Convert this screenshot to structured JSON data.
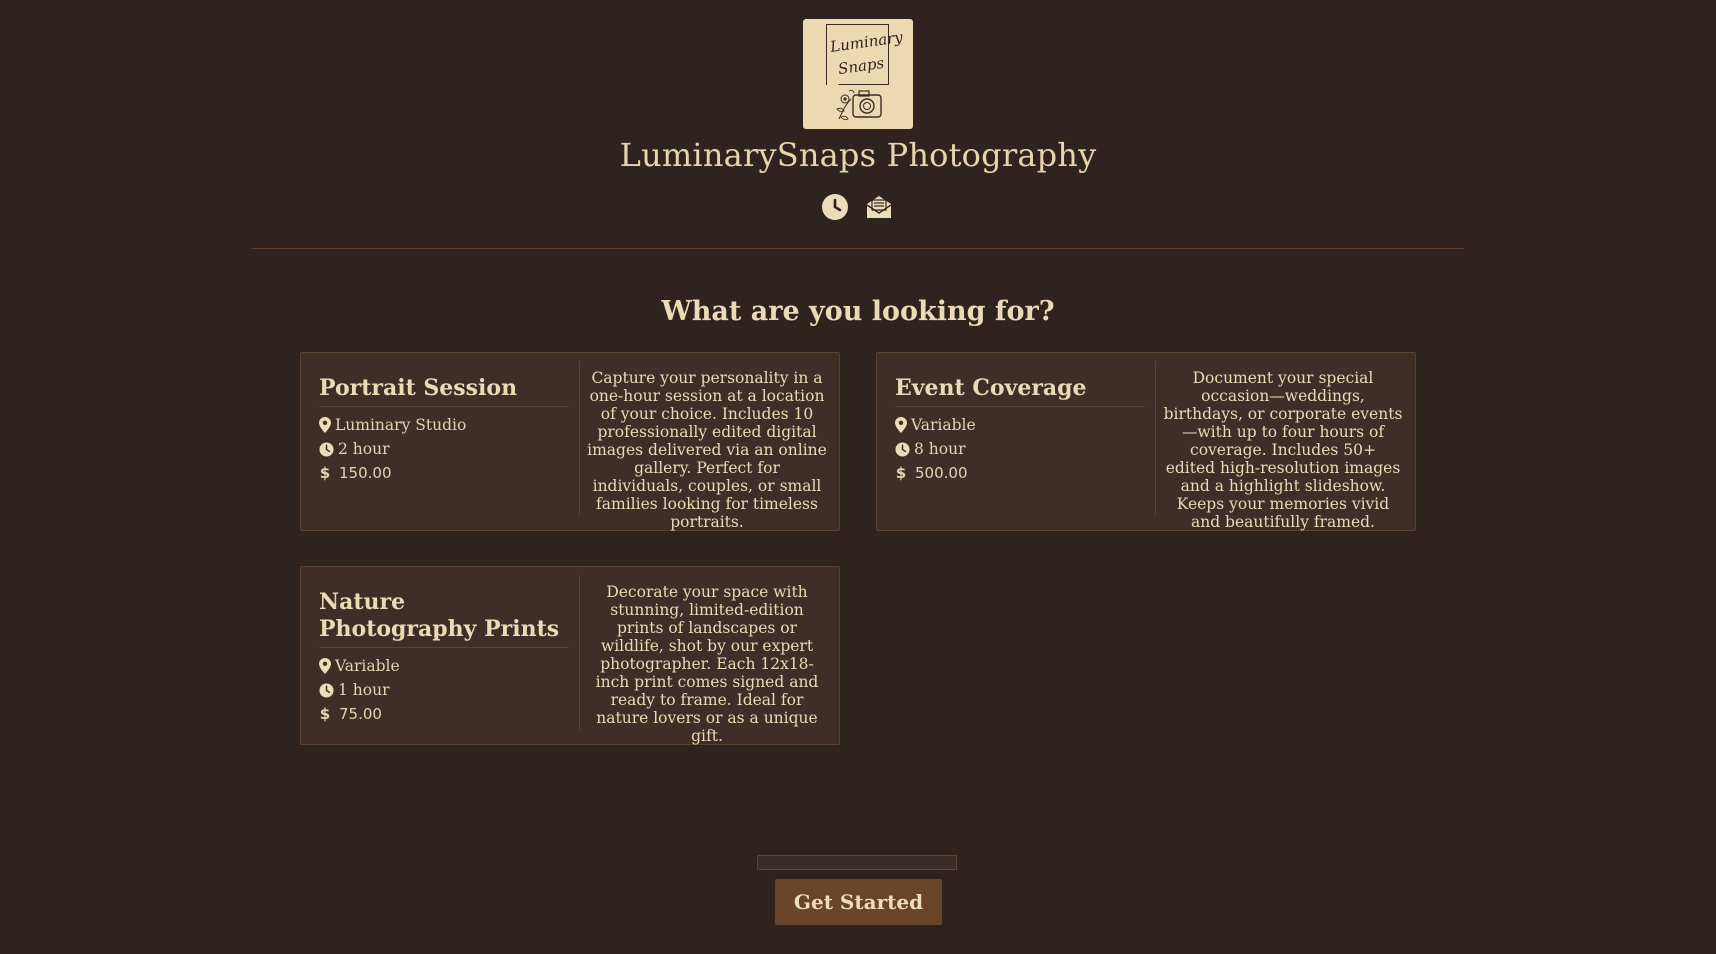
{
  "brand": {
    "logo_line1": "Luminary",
    "logo_line2": "Snaps",
    "title": "LuminarySnaps Photography"
  },
  "header_icons": [
    "clock-icon",
    "envelope-icon"
  ],
  "section": {
    "question": "What are you looking for?"
  },
  "services": [
    {
      "name": "Portrait Session",
      "location": "Luminary Studio",
      "duration": "2 hour",
      "price": "150.00",
      "description": "Capture your personality in a one-hour session at a location of your choice. Includes 10 professionally edited digital images delivered via an online gallery. Perfect for individuals, couples, or small families looking for timeless portraits."
    },
    {
      "name": "Event Coverage",
      "location": "Variable",
      "duration": "8 hour",
      "price": "500.00",
      "description": "Document your special occasion—weddings, birthdays, or corporate events—with up to four hours of coverage. Includes 50+ edited high-resolution images and a highlight slideshow. Keeps your memories vivid and beautifully framed."
    },
    {
      "name": "Nature Photography Prints",
      "location": "Variable",
      "duration": "1 hour",
      "price": "75.00",
      "description": "Decorate your space with stunning, limited-edition prints of landscapes or wildlife, shot by our expert photographer. Each 12x18-inch print comes signed and ready to frame. Ideal for nature lovers or as a unique gift."
    }
  ],
  "currency_symbol": "$",
  "progress": {
    "fraction": 0
  },
  "cta": {
    "label": "Get Started"
  },
  "colors": {
    "background": "#2e231e",
    "card": "#3e2e27",
    "accent_button": "#6a4428",
    "text": "#ecd9b6"
  }
}
